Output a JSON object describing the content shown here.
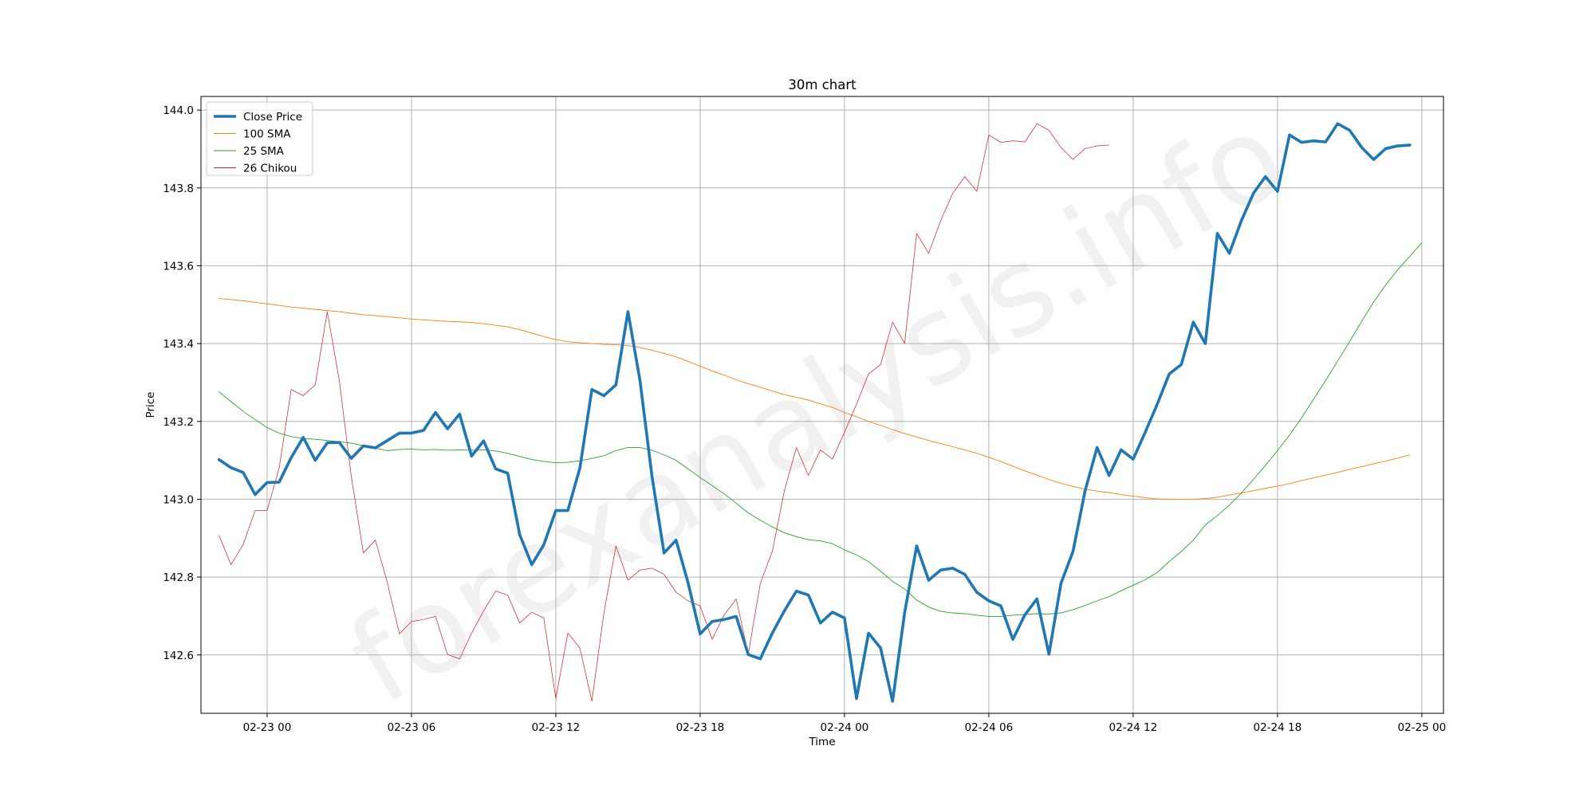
{
  "chart_data": {
    "type": "line",
    "title": "30m chart",
    "xlabel": "Time",
    "ylabel": "Price",
    "watermark": "forexanalysis.info",
    "x_ticks": [
      {
        "t": 4,
        "label": "02-23 00"
      },
      {
        "t": 16,
        "label": "02-23 06"
      },
      {
        "t": 28,
        "label": "02-23 12"
      },
      {
        "t": 40,
        "label": "02-23 18"
      },
      {
        "t": 52,
        "label": "02-24 00"
      },
      {
        "t": 64,
        "label": "02-24 06"
      },
      {
        "t": 76,
        "label": "02-24 12"
      },
      {
        "t": 88,
        "label": "02-24 18"
      },
      {
        "t": 100,
        "label": "02-25 00"
      }
    ],
    "xlim": [
      -1.5,
      101.8
    ],
    "y_ticks": [
      142.6,
      142.8,
      143.0,
      143.2,
      143.4,
      143.6,
      143.8,
      144.0
    ],
    "ylim": [
      142.45,
      144.035
    ],
    "grid": true,
    "legend_position": "top-left",
    "series": [
      {
        "name": "Close Price",
        "color": "#1f77b4",
        "width": 3.6,
        "start": 0,
        "values": [
          143.102,
          143.081,
          143.069,
          143.012,
          143.043,
          143.044,
          143.107,
          143.159,
          143.1,
          143.145,
          143.146,
          143.105,
          143.137,
          143.132,
          143.151,
          143.17,
          143.17,
          143.177,
          143.223,
          143.181,
          143.219,
          143.111,
          143.15,
          143.078,
          143.067,
          142.909,
          142.832,
          142.883,
          142.971,
          142.971,
          143.08,
          143.282,
          143.266,
          143.294,
          143.482,
          143.305,
          143.058,
          142.862,
          142.895,
          142.785,
          142.654,
          142.686,
          142.691,
          142.699,
          142.601,
          142.59,
          142.656,
          142.713,
          142.764,
          142.754,
          142.682,
          142.71,
          142.695,
          142.488,
          142.656,
          142.618,
          142.481,
          142.708,
          142.88,
          142.792,
          142.818,
          142.823,
          142.807,
          142.761,
          142.739,
          142.726,
          142.64,
          142.703,
          142.744,
          142.602,
          142.784,
          142.866,
          143.021,
          143.133,
          143.061,
          143.127,
          143.103,
          143.172,
          143.244,
          143.322,
          143.346,
          143.455,
          143.4,
          143.683,
          143.632,
          143.716,
          143.786,
          143.829,
          143.791,
          143.936,
          143.917,
          143.921,
          143.918,
          143.965,
          143.948,
          143.904,
          143.873,
          143.901,
          143.908,
          143.91
        ]
      },
      {
        "name": "100 SMA",
        "color": "#ff7f0e",
        "width": 0.9,
        "start": 0,
        "values": [
          143.516,
          143.513,
          143.51,
          143.506,
          143.502,
          143.498,
          143.494,
          143.491,
          143.488,
          143.485,
          143.482,
          143.478,
          143.474,
          143.472,
          143.469,
          143.466,
          143.463,
          143.461,
          143.459,
          143.457,
          143.456,
          143.454,
          143.451,
          143.447,
          143.443,
          143.436,
          143.427,
          143.418,
          143.41,
          143.405,
          143.402,
          143.4,
          143.398,
          143.397,
          143.395,
          143.39,
          143.383,
          143.375,
          143.366,
          143.354,
          143.342,
          143.33,
          143.319,
          143.307,
          143.297,
          143.288,
          143.278,
          143.269,
          143.262,
          143.255,
          143.245,
          143.236,
          143.223,
          143.212,
          143.2,
          143.19,
          143.179,
          143.169,
          143.16,
          143.151,
          143.143,
          143.135,
          143.127,
          143.118,
          143.108,
          143.097,
          143.085,
          143.073,
          143.062,
          143.051,
          143.041,
          143.033,
          143.026,
          143.021,
          143.017,
          143.012,
          143.008,
          143.004,
          143.001,
          143.0,
          143.0,
          143.0,
          143.002,
          143.005,
          143.011,
          143.016,
          143.022,
          143.028,
          143.034,
          143.04,
          143.048,
          143.055,
          143.062,
          143.069,
          143.077,
          143.084,
          143.091,
          143.098,
          143.106,
          143.114
        ]
      },
      {
        "name": "25 SMA",
        "color": "#2ca02c",
        "width": 0.9,
        "start": 0,
        "values": [
          143.276,
          143.251,
          143.226,
          143.205,
          143.184,
          143.17,
          143.161,
          143.156,
          143.154,
          143.151,
          143.148,
          143.144,
          143.138,
          143.131,
          143.125,
          143.128,
          143.129,
          143.127,
          143.128,
          143.126,
          143.127,
          143.126,
          143.127,
          143.124,
          143.118,
          143.11,
          143.102,
          143.097,
          143.094,
          143.095,
          143.099,
          143.105,
          143.112,
          143.125,
          143.133,
          143.133,
          143.126,
          143.114,
          143.1,
          143.078,
          143.056,
          143.035,
          143.014,
          142.99,
          142.965,
          142.946,
          142.929,
          142.914,
          142.904,
          142.896,
          142.893,
          142.886,
          142.87,
          142.857,
          142.84,
          142.815,
          142.789,
          142.769,
          142.741,
          142.723,
          142.712,
          142.708,
          142.706,
          142.702,
          142.699,
          142.699,
          142.702,
          142.704,
          142.706,
          142.705,
          142.708,
          142.716,
          142.727,
          142.739,
          142.75,
          142.765,
          142.779,
          142.793,
          142.812,
          142.84,
          142.866,
          142.895,
          142.934,
          142.958,
          142.985,
          143.016,
          143.051,
          143.087,
          143.125,
          143.165,
          143.209,
          143.257,
          143.305,
          143.355,
          143.405,
          143.457,
          143.507,
          143.551,
          143.59,
          143.624,
          143.659
        ]
      },
      {
        "name": "26 Chikou",
        "color": "#d62728",
        "width": 0.75,
        "start": 0,
        "values": [
          142.907,
          142.832,
          142.883,
          142.971,
          142.971,
          143.08,
          143.282,
          143.266,
          143.294,
          143.482,
          143.305,
          143.058,
          142.862,
          142.895,
          142.785,
          142.654,
          142.686,
          142.691,
          142.699,
          142.601,
          142.59,
          142.656,
          142.713,
          142.764,
          142.754,
          142.682,
          142.71,
          142.695,
          142.488,
          142.656,
          142.618,
          142.481,
          142.708,
          142.88,
          142.792,
          142.818,
          142.823,
          142.807,
          142.761,
          142.739,
          142.726,
          142.64,
          142.703,
          142.744,
          142.602,
          142.784,
          142.866,
          143.021,
          143.133,
          143.061,
          143.127,
          143.103,
          143.172,
          143.244,
          143.322,
          143.346,
          143.455,
          143.4,
          143.683,
          143.632,
          143.716,
          143.786,
          143.829,
          143.791,
          143.936,
          143.917,
          143.921,
          143.918,
          143.965,
          143.948,
          143.904,
          143.873,
          143.901,
          143.908,
          143.91
        ]
      }
    ]
  }
}
